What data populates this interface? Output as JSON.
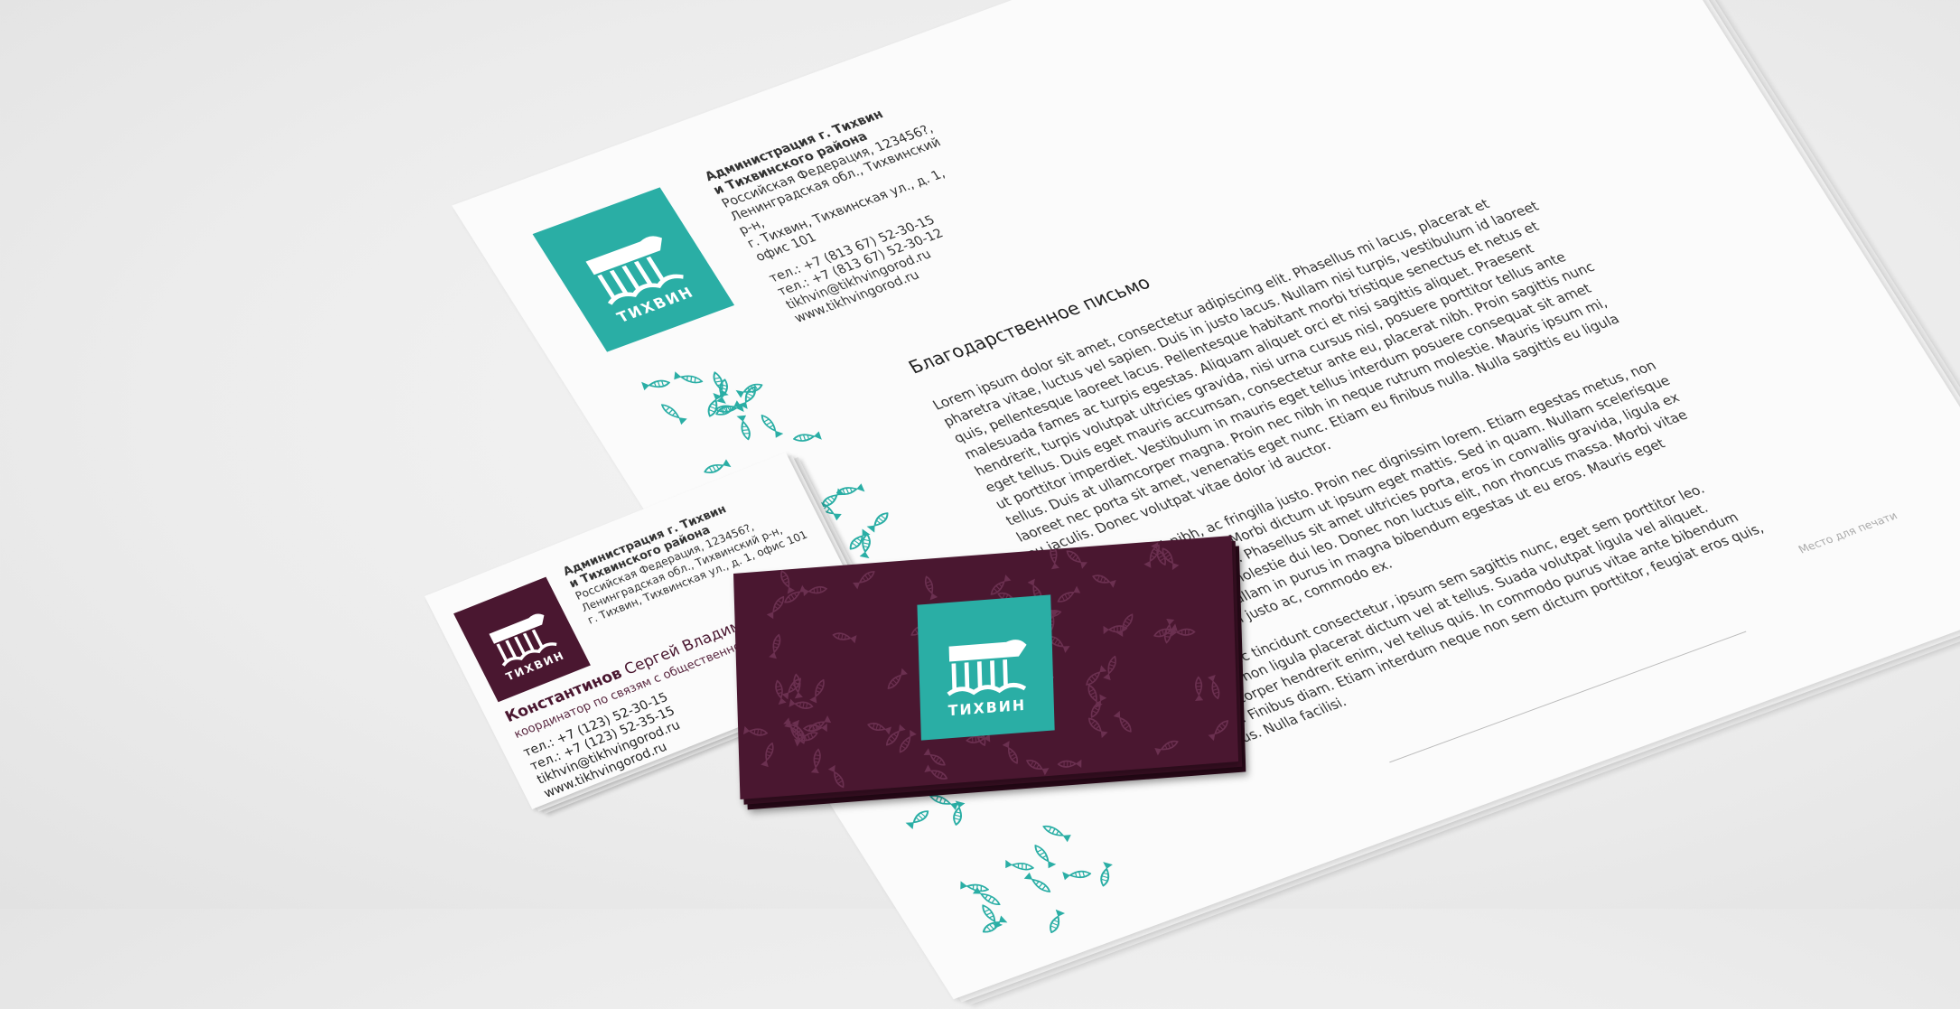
{
  "brand": {
    "teal": "#2aaea5",
    "plum": "#4a1730",
    "logo_word": "ТИХВИН"
  },
  "letterhead": {
    "org_line1": "Администрация г. Тихвин",
    "org_line2": "и Тихвинского района",
    "address_line1": "Российская Федерация, 123456?,",
    "address_line2": "Ленинградская обл., Тихвинский р-н,",
    "address_line3": "г. Тихвин, Тихвинская ул., д. 1, офис 101",
    "phone1": "тел.: +7 (813 67) 52-30-15",
    "phone2": "тел.: +7 (813 67) 52-30-12",
    "email": "tikhvin@tikhvingorod.ru",
    "website": "www.tikhvingorod.ru",
    "title": "Благодарственное письмо",
    "paragraph1": "Lorem ipsum dolor sit amet, consectetur adipiscing elit. Phasellus mi lacus, placerat et pharetra vitae, luctus vel sapien. Duis in justo lacus. Nullam nisi turpis, vestibulum id laoreet quis, pellentesque laoreet lacus. Pellentesque habitant morbi tristique senectus et netus et malesuada fames ac turpis egestas. Aliquam aliquet orci et nisi sagittis aliquet. Praesent hendrerit, turpis volutpat ultricies gravida, nisi urna cursus nisl, posuere porttitor tellus ante eget tellus. Duis eget mauris accumsan, consectetur ante eu, placerat nibh. Proin sagittis nunc ut porttitor imperdiet. Vestibulum in mauris eget tellus interdum posuere consequat sit amet tellus. Duis at ullamcorper magna. Proin nec nibh in neque rutrum molestie. Mauris ipsum mi, laoreet nec porta sit amet, venenatis eget nunc. Etiam eu finibus nulla. Nulla sagittis eu ligula eu iaculis. Donec volutpat vitae dolor id auctor.",
    "paragraph2": "Nam vel imperdiet nibh, ac fringilla justo. Proin nec dignissim lorem. Etiam egestas metus, non tristique diam hendrerit a. Morbi dictum ut ipsum eget mattis. Sed in quam. Nullam scelerisque eu arcu dignissim eleifend. Phasellus sit amet ultricies porta, eros in convallis gravida, ligula ex hendrerit nibh, semper molestie dui leo. Donec non luctus elit, non rhoncus massa. Morbi vitae ante id orci aliquam. Nullam in purus in magna bibendum egestas ut eu eros. Mauris eget elementum, dignissim justo ac, commodo ex.",
    "paragraph3": "Fermentum, eros ac tincidunt consectetur, ipsum sem sagittis nunc, eget sem porttitor leo. Morbi vitae enim non ligula placerat dictum vel at tellus. Suada volutpat ligula vel aliquet. Praesent ullamcorper hendrerit enim, vel tellus quis. In commodo purus vitae ante bibendum condimentum. Finibus diam. Etiam interdum neque non sem dictum porttitor, feugiat eros quis, vehicula purus. Nulla facilisi.",
    "seal_label": "Место для печати"
  },
  "business_card_white": {
    "org_line1": "Администрация г. Тихвин",
    "org_line2": "и Тихвинского района",
    "address_line1": "Российская Федерация, 123456?,",
    "address_line2": "Ленинградская обл., Тихвинский р-н,",
    "address_line3": "г. Тихвин, Тихвинская ул., д. 1, офис 101",
    "surname": "Константинов",
    "given_names": "Сергей Владимирович",
    "role": "координатор по связям с общественностью",
    "phone1": "тел.: +7 (123) 52-30-15",
    "phone2": "тел.: +7 (123) 52-35-15",
    "email": "tikhvin@tikhvingorod.ru",
    "website": "www.tikhvingorod.ru"
  },
  "business_card_purple": {
    "logo_word": "ТИХВИН"
  }
}
